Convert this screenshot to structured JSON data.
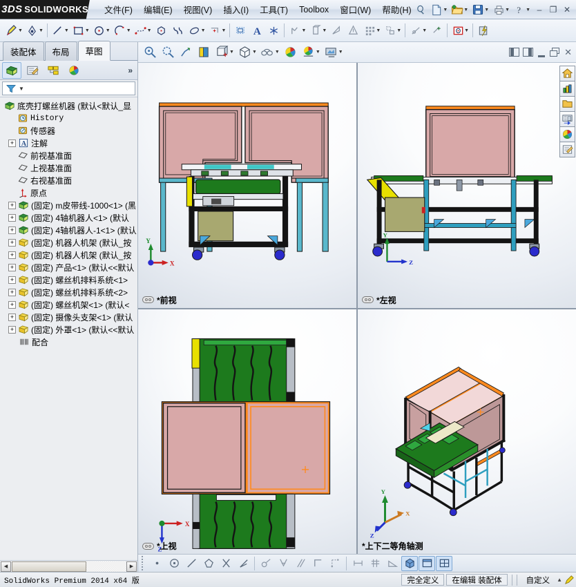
{
  "app": {
    "brand_ds": "3DS",
    "brand_name": "SOLIDWORKS"
  },
  "menu": {
    "items": [
      {
        "label": "文件(F)",
        "name": "menu-file"
      },
      {
        "label": "编辑(E)",
        "name": "menu-edit"
      },
      {
        "label": "视图(V)",
        "name": "menu-view"
      },
      {
        "label": "插入(I)",
        "name": "menu-insert"
      },
      {
        "label": "工具(T)",
        "name": "menu-tools"
      },
      {
        "label": "Toolbox",
        "name": "menu-toolbox"
      },
      {
        "label": "窗口(W)",
        "name": "menu-window"
      },
      {
        "label": "帮助(H)",
        "name": "menu-help"
      }
    ]
  },
  "titlebar_buttons": {
    "minimize": "–",
    "restore": "❐",
    "close": "✕"
  },
  "left_panel": {
    "tabs": [
      {
        "label": "装配体",
        "name": "tab-assembly",
        "active": false
      },
      {
        "label": "布局",
        "name": "tab-layout",
        "active": false
      },
      {
        "label": "草图",
        "name": "tab-sketch",
        "active": true
      }
    ],
    "manager_icons": [
      {
        "name": "feature-manager-tree-icon",
        "selected": true
      },
      {
        "name": "property-manager-icon",
        "selected": false
      },
      {
        "name": "configuration-manager-icon",
        "selected": false
      },
      {
        "name": "display-manager-icon",
        "selected": false
      }
    ],
    "expand_chevron": "»",
    "filter_placeholder": ""
  },
  "tree": {
    "root": {
      "label": "底壳打螺丝机器",
      "suffix": "(默认<默认_显"
    },
    "items": [
      {
        "label": "History",
        "icon": "history-icon",
        "expandable": false,
        "mono": true
      },
      {
        "label": "传感器",
        "icon": "sensor-icon",
        "expandable": false,
        "mono": false
      },
      {
        "label": "注解",
        "icon": "annotation-icon",
        "expandable": true,
        "mono": false
      },
      {
        "label": "前视基准面",
        "icon": "plane-icon",
        "expandable": false,
        "mono": false
      },
      {
        "label": "上视基准面",
        "icon": "plane-icon",
        "expandable": false,
        "mono": false
      },
      {
        "label": "右视基准面",
        "icon": "plane-icon",
        "expandable": false,
        "mono": false
      },
      {
        "label": "原点",
        "icon": "origin-icon",
        "expandable": false,
        "mono": false
      },
      {
        "label": "(固定) m皮带线-1000<1> (黑",
        "icon": "assembly-icon",
        "expandable": true,
        "mono": false
      },
      {
        "label": "(固定) 4轴机器人<1> (默认",
        "icon": "assembly-icon",
        "expandable": true,
        "mono": false
      },
      {
        "label": "(固定) 4轴机器人-1<1> (默认",
        "icon": "assembly-icon",
        "expandable": true,
        "mono": false
      },
      {
        "label": "(固定) 机器人机架 (默认_按",
        "icon": "part-icon",
        "expandable": true,
        "mono": false
      },
      {
        "label": "(固定) 机器人机架 (默认_按",
        "icon": "part-icon",
        "expandable": true,
        "mono": false
      },
      {
        "label": "(固定) 产品<1> (默认<<默认",
        "icon": "part-icon",
        "expandable": true,
        "mono": false
      },
      {
        "label": "(固定) 螺丝机排料系统<1>",
        "icon": "part-icon",
        "expandable": true,
        "mono": false
      },
      {
        "label": "(固定) 螺丝机排料系统<2>",
        "icon": "part-icon",
        "expandable": true,
        "mono": false
      },
      {
        "label": "(固定) 螺丝机架<1> (默认<",
        "icon": "part-icon",
        "expandable": true,
        "mono": false
      },
      {
        "label": "(固定) 摄像头支架<1> (默认",
        "icon": "part-icon",
        "expandable": true,
        "mono": false
      },
      {
        "label": "(固定) 外罩<1> (默认<<默认",
        "icon": "part-icon",
        "expandable": true,
        "mono": false
      },
      {
        "label": "配合",
        "icon": "mates-icon",
        "expandable": false,
        "mono": false
      }
    ]
  },
  "viewports": [
    {
      "name": "viewport-front",
      "label": "*前视",
      "linked": true,
      "triad": {
        "up": "Y",
        "right": "X",
        "up_color": "#1f8b2f",
        "right_color": "#cc2222"
      }
    },
    {
      "name": "viewport-left",
      "label": "*左视",
      "linked": true,
      "triad": {
        "up": "Y",
        "right": "Z",
        "up_color": "#1f8b2f",
        "right_color": "#2233cc"
      }
    },
    {
      "name": "viewport-top",
      "label": "*上视",
      "linked": true,
      "triad": {
        "up": "X",
        "right": "Z",
        "up_color": "#cc2222",
        "right_color": "#2233cc"
      }
    },
    {
      "name": "viewport-isometric",
      "label": "*上下二等角轴测",
      "linked": false,
      "triad": {
        "up": "Y",
        "right": "X",
        "up_color": "#1f8b2f",
        "right_color": "#cc7a22"
      }
    }
  ],
  "task_pane": {
    "icons": [
      {
        "name": "sw-resources-home-icon"
      },
      {
        "name": "design-library-icon"
      },
      {
        "name": "file-explorer-folder-icon"
      },
      {
        "name": "view-palette-icon"
      },
      {
        "name": "appearances-scenes-icon"
      },
      {
        "name": "custom-properties-icon"
      }
    ]
  },
  "status_bar": {
    "version_text": "SolidWorks Premium 2014 x64 版",
    "state": "完全定义",
    "editing": "在编辑 装配体",
    "units": "自定义",
    "units_arrow": "▲"
  },
  "colors": {
    "accent_orange": "#ff8a1e",
    "selection_blue": "#3a6ea5",
    "model_pink": "#d8a8a8",
    "model_green": "#1d7a1d",
    "model_yellow": "#e8e000",
    "model_cyan": "#4fb8c8",
    "frame_black": "#1a1a1a",
    "triad_green": "#1f8b2f",
    "triad_red": "#cc2222",
    "triad_blue": "#2233cc"
  }
}
